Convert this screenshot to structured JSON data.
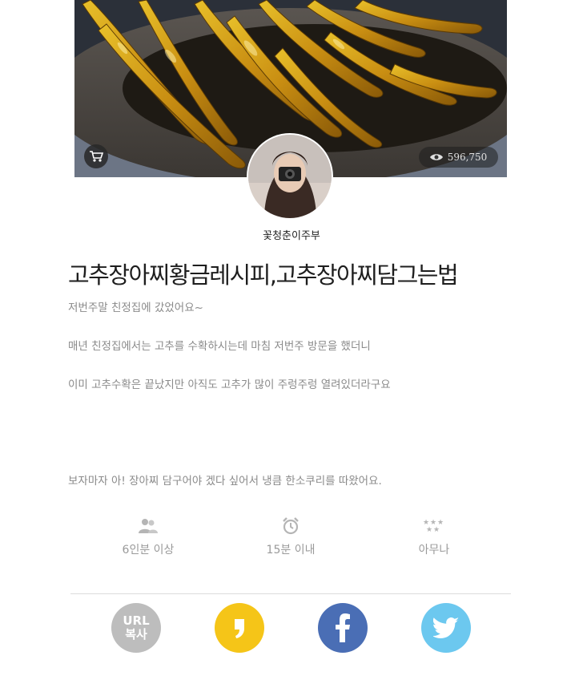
{
  "hero": {
    "views": "596,750",
    "cart_icon": "cart-icon",
    "eye_icon": "eye-icon"
  },
  "author": {
    "name": "꽃청춘이주부"
  },
  "recipe": {
    "title": "고추장아찌황금레시피,고추장아찌담그는법",
    "paragraphs": [
      "저번주말 친정집에 갔었어요~",
      "매년 친정집에서는 고추를 수확하시는데 마침 저번주 방문을 했더니",
      "이미 고추수확은 끝났지만 아직도 고추가 많이 주렁주렁 열려있더라구요",
      "보자마자 아! 장아찌 담구어야 겠다 싶어서 냉큼 한소쿠리를 따왔어요."
    ]
  },
  "info": {
    "servings": "6인분 이상",
    "time": "15분 이내",
    "difficulty": "아무나"
  },
  "share": {
    "url_line1": "URL",
    "url_line2": "복사"
  },
  "colors": {
    "kakao": "#f5c518",
    "facebook": "#4a6eb5",
    "twitter": "#6cc8ef",
    "url": "#bdbdbd"
  }
}
